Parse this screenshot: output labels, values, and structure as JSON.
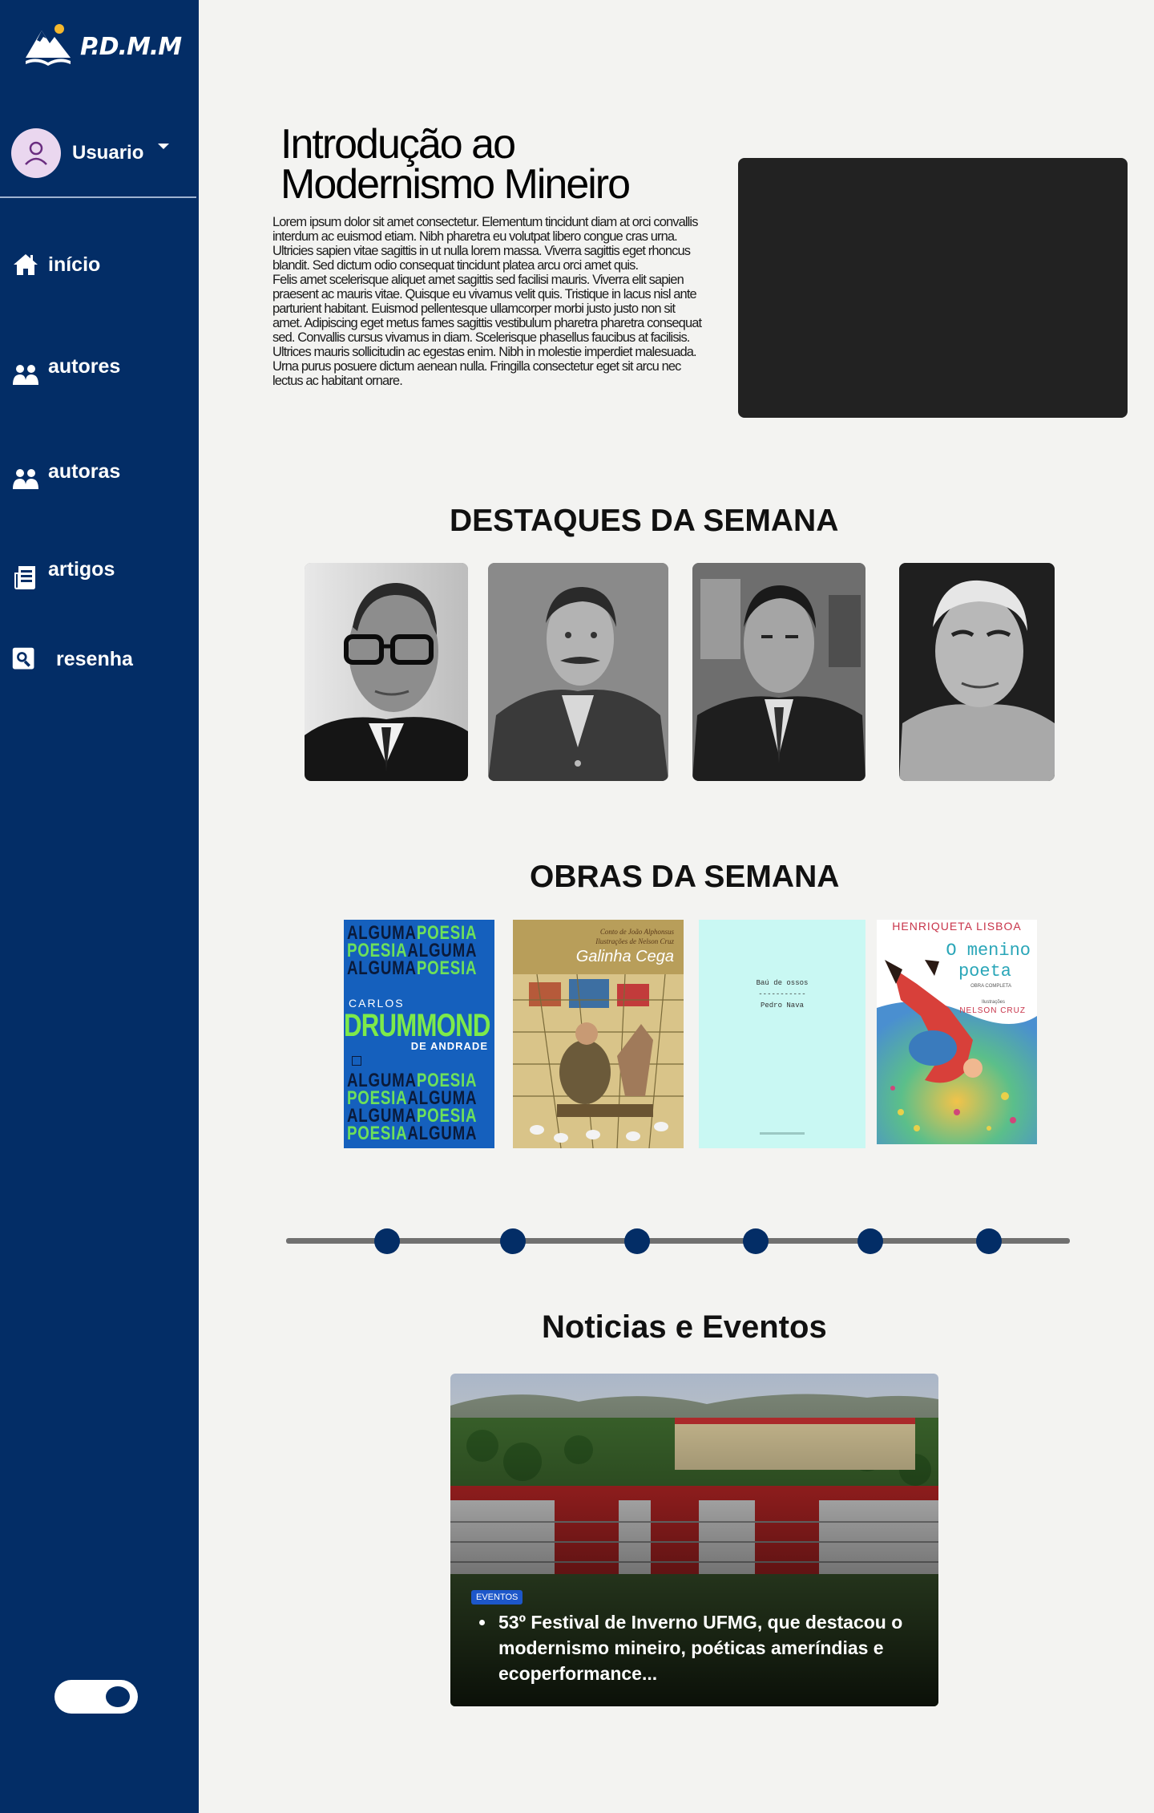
{
  "sidebar": {
    "logo_text": "P.D.M.M",
    "user_label": "Usuario",
    "items": [
      {
        "label": "início",
        "icon": "home-icon"
      },
      {
        "label": "autores",
        "icon": "users-icon"
      },
      {
        "label": "autoras",
        "icon": "users-icon"
      },
      {
        "label": "artigos",
        "icon": "article-icon"
      },
      {
        "label": "resenha",
        "icon": "search-icon"
      }
    ],
    "theme_toggle_on": true
  },
  "intro": {
    "title": "Introdução ao Modernismo Mineiro",
    "body": "Lorem ipsum dolor sit amet consectetur. Elementum tincidunt diam at orci convallis interdum ac euismod etiam. Nibh pharetra eu volutpat libero congue cras urna. Ultricies sapien vitae sagittis in ut nulla lorem massa. Viverra sagittis eget rhoncus blandit. Sed dictum odio consequat tincidunt platea arcu orci amet quis.\nFelis amet scelerisque aliquet amet sagittis sed facilisi mauris. Viverra elit sapien praesent ac mauris vitae. Quisque eu vivamus velit quis. Tristique in lacus nisl ante parturient habitant. Euismod pellentesque ullamcorper morbi justo justo non sit amet. Adipiscing eget metus fames sagittis vestibulum pharetra pharetra consequat sed. Convallis cursus vivamus in diam. Scelerisque phasellus faucibus at facilisis. Ultrices mauris sollicitudin ac egestas enim. Nibh in molestie imperdiet malesuada. Urna purus posuere dictum aenean nulla. Fringilla consectetur eget sit arcu nec lectus ac habitant ornare."
  },
  "highlights": {
    "title": "DESTAQUES DA SEMANA"
  },
  "works": {
    "title": "OBRAS DA SEMANA",
    "book1": {
      "rows": [
        [
          "ALGUMA",
          "POESIA"
        ],
        [
          "POESIA",
          "ALGUMA"
        ],
        [
          "ALGUMA",
          "POESIA"
        ]
      ],
      "author_first": "CARLOS",
      "author_last": "DRUMMOND",
      "author_suffix": "DE ANDRADE"
    },
    "book2": {
      "credit_line1": "Conto de João Alphonsus",
      "credit_line2": "Ilustrações de Nelson Cruz",
      "title": "Galinha Cega"
    },
    "book3": {
      "title": "Baú de ossos",
      "separator": "-----------",
      "author": "Pedro Nava"
    },
    "book4": {
      "author": "Henriqueta Lisboa",
      "title_line1": "O menino",
      "title_line2": "poeta",
      "subtitle": "Obra Completa",
      "illustrator_label": "Ilustrações",
      "illustrator": "Nelson Cruz"
    }
  },
  "news": {
    "title": "Noticias e Eventos",
    "badge": "EVENTOS",
    "headline": "53º Festival de Inverno UFMG, que destacou o modernismo mineiro, poéticas ameríndias e ecoperformance..."
  }
}
